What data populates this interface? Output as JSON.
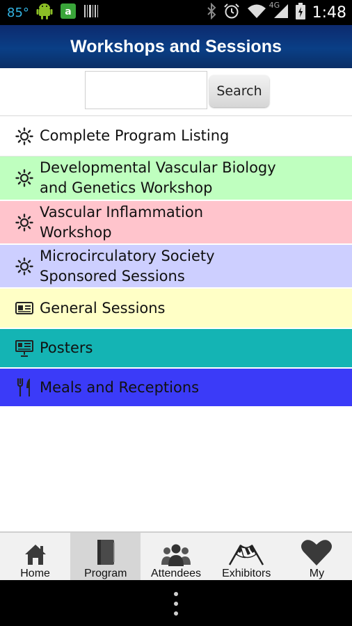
{
  "status_bar": {
    "temperature": "85°",
    "network": "4G",
    "time": "1:48",
    "icons": [
      "android-robot-icon",
      "amazon-app-icon",
      "barcode-icon",
      "bluetooth-icon",
      "alarm-icon",
      "wifi-icon",
      "signal-icon",
      "battery-icon"
    ]
  },
  "header": {
    "title": "Workshops and Sessions"
  },
  "search": {
    "value": "",
    "placeholder": "",
    "button_label": "Search"
  },
  "list": {
    "items": [
      {
        "label": "Complete Program Listing",
        "icon": "sun-icon",
        "color": "#ffffff"
      },
      {
        "label": "Developmental Vascular Biology\nand Genetics Workshop",
        "icon": "sun-icon",
        "color": "#bfffbf"
      },
      {
        "label": "Vascular Inflammation\nWorkshop",
        "icon": "sun-icon",
        "color": "#ffc4cc"
      },
      {
        "label": "Microcirculatory Society\nSponsored Sessions",
        "icon": "sun-icon",
        "color": "#cdcfff"
      },
      {
        "label": "General Sessions",
        "icon": "id-card-icon",
        "color": "#ffffc6"
      },
      {
        "label": "Posters",
        "icon": "presentation-board-icon",
        "color": "#14b4b4"
      },
      {
        "label": "Meals and Receptions",
        "icon": "fork-knife-icon",
        "color": "#3b3bf8"
      }
    ]
  },
  "tabs": {
    "items": [
      {
        "label": "Home",
        "icon": "home-icon",
        "active": false
      },
      {
        "label": "Program",
        "icon": "book-icon",
        "active": true
      },
      {
        "label": "Attendees",
        "icon": "people-icon",
        "active": false
      },
      {
        "label": "Exhibitors",
        "icon": "checkered-flags-icon",
        "active": false
      },
      {
        "label": "My",
        "icon": "heart-icon",
        "active": false
      }
    ]
  },
  "nav_bar": {
    "menu_icon": "overflow-menu-icon"
  }
}
